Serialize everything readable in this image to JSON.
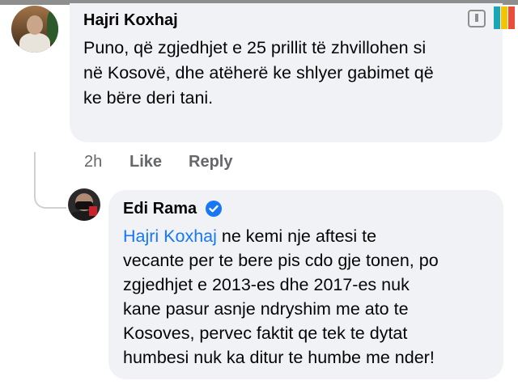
{
  "comments": [
    {
      "author": "Hajri Koxhaj",
      "lines": [
        "Puno, që zgjedhjet e 25 prillit të zhvillohen si",
        "në Kosovë, dhe atëherë ke shlyer gabimet që",
        "ke bëre deri tani."
      ],
      "time": "2h",
      "like_label": "Like",
      "reply_label": "Reply"
    }
  ],
  "reply": {
    "author": "Edi Rama",
    "verified": true,
    "mention": "Hajri Koxhaj",
    "first_line_rest": " ne kemi nje aftesi te",
    "lines": [
      "vecante per te bere pis cdo gje tonen, po",
      "zgjedhjet e 2013-es dhe 2017-es nuk",
      "kane pasur asnje ndryshim me ato te",
      "Kosoves, pervec faktit qe tek te dytat",
      "humbesi nuk ka ditur te humbe me nder!"
    ]
  },
  "colors": {
    "bubble": "#f0f2f5",
    "link": "#1877f2",
    "meta": "#65676b"
  },
  "icons": [
    "avatar",
    "verified-badge-icon",
    "share-icon"
  ]
}
